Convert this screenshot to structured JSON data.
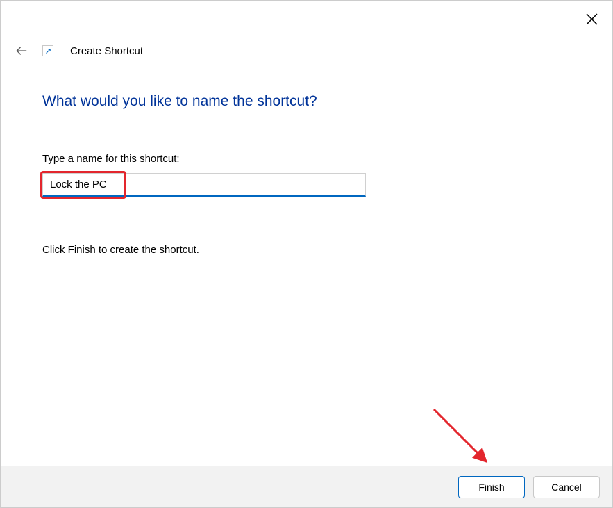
{
  "window": {
    "wizard_title": "Create Shortcut"
  },
  "content": {
    "heading": "What would you like to name the shortcut?",
    "field_label": "Type a name for this shortcut:",
    "input_value": "Lock the PC",
    "instruction": "Click Finish to create the shortcut."
  },
  "footer": {
    "finish_label": "Finish",
    "cancel_label": "Cancel"
  },
  "annotations": {
    "highlight_color": "#e3262d",
    "arrow_color": "#e3262d"
  }
}
